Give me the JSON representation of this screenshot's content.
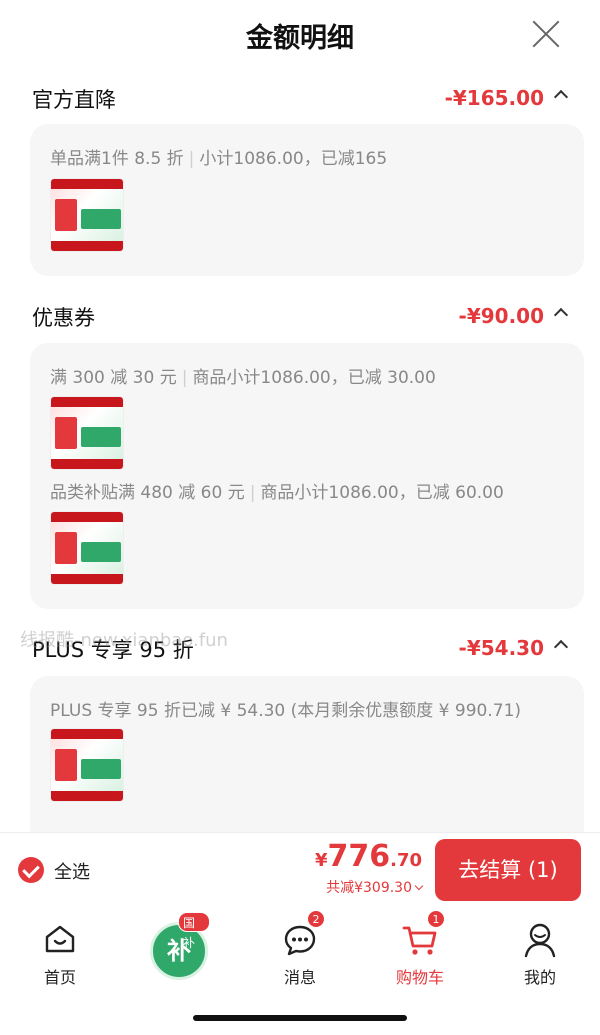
{
  "sheet": {
    "title": "金额明细"
  },
  "sections": {
    "official": {
      "name": "官方直降",
      "amount": "-¥165.00",
      "details": [
        {
          "rule": "单品满1件 8.5 折",
          "summary": "小计1086.00，已减165"
        }
      ]
    },
    "coupon": {
      "name": "优惠券",
      "amount": "-¥90.00",
      "details": [
        {
          "rule": "满 300 减 30 元",
          "summary": "商品小计1086.00，已减 30.00"
        },
        {
          "rule": "品类补贴满 480 减 60 元",
          "summary": "商品小计1086.00，已减 60.00"
        }
      ]
    },
    "plus": {
      "name": "PLUS 专享 95 折",
      "amount": "-¥54.30",
      "details": [
        {
          "text": "PLUS 专享 95 折已减 ¥ 54.30 (本月剩余优惠额度 ¥ 990.71)"
        }
      ]
    }
  },
  "watermark": "线报酷-new.xianbao.fun",
  "checkout": {
    "select_all_label": "全选",
    "currency": "¥",
    "total_integer": "776",
    "total_decimal": ".70",
    "discount_text": "共减¥309.30",
    "checkout_button": "去结算 (1)"
  },
  "tabbar": {
    "home": {
      "label": "首页",
      "icon": "home-icon"
    },
    "subsidy": {
      "char": "补",
      "tag": "国补",
      "icon": "subsidy-icon"
    },
    "messages": {
      "label": "消息",
      "badge": "2",
      "icon": "message-icon"
    },
    "cart": {
      "label": "购物车",
      "badge": "1",
      "icon": "cart-icon"
    },
    "me": {
      "label": "我的",
      "icon": "user-icon"
    }
  },
  "colors": {
    "accent": "#e4393c",
    "subsidy_green": "#2fa86a",
    "card_bg": "#f6f6f6"
  }
}
